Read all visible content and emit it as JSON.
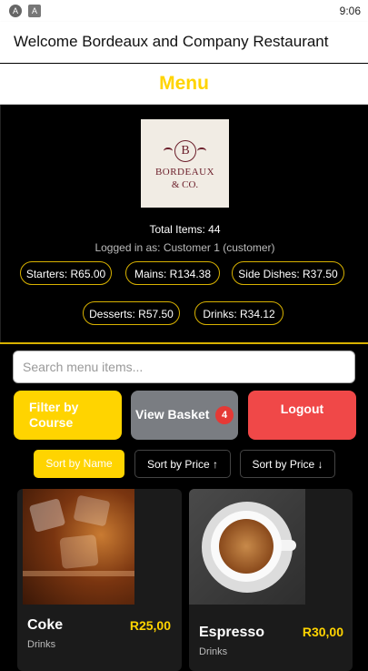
{
  "status_bar": {
    "time": "9:06",
    "icons": [
      "app-icon-1",
      "app-icon-2"
    ]
  },
  "app_bar": {
    "title": "Welcome Bordeaux and Company Restaurant"
  },
  "menu_header": {
    "title": "Menu"
  },
  "logo": {
    "monogram": "B",
    "line1": "BORDEAUX",
    "line2": "& CO."
  },
  "summary": {
    "total_items": "Total Items: 44",
    "logged_in": "Logged in as: Customer 1 (customer)"
  },
  "averages": [
    "Starters: R65.00",
    "Mains: R134.38",
    "Side Dishes: R37.50",
    "Desserts: R57.50",
    "Drinks: R34.12"
  ],
  "search": {
    "placeholder": "Search menu items..."
  },
  "actions": {
    "filter_line1": "Filter by",
    "filter_line2": "Course",
    "view_basket": "View Basket",
    "basket_count": "4",
    "logout": "Logout"
  },
  "sort": {
    "by_name": "Sort by Name",
    "price_up": "Sort by Price ↑",
    "price_down": "Sort by Price ↓"
  },
  "items": [
    {
      "name": "Coke",
      "price": "R25,00",
      "category": "Drinks"
    },
    {
      "name": "Espresso",
      "price": "R30,00",
      "category": "Drinks"
    }
  ],
  "colors": {
    "accent": "#FFD400",
    "logout": "#F04848",
    "basket": "#7A7D82",
    "badge": "#E53935"
  }
}
